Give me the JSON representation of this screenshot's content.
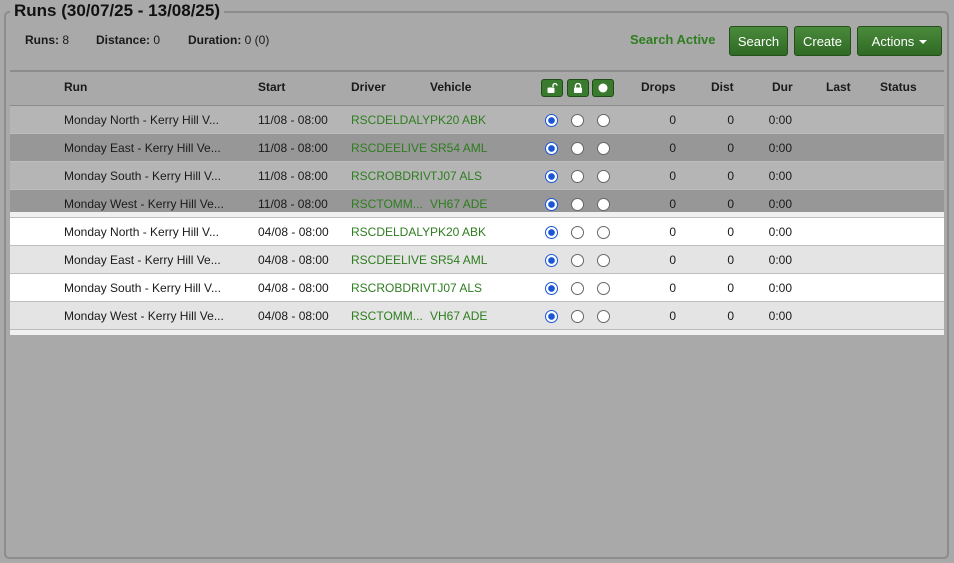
{
  "panel": {
    "title": "Runs (30/07/25 - 13/08/25)"
  },
  "stats": {
    "runs_label": "Runs:",
    "runs_value": "8",
    "distance_label": "Distance:",
    "distance_value": "0",
    "duration_label": "Duration:",
    "duration_value": "0 (0)"
  },
  "toolbar": {
    "search_status": "Search Active",
    "search_label": "Search",
    "create_label": "Create",
    "actions_label": "Actions"
  },
  "colors": {
    "accent_green": "#2e7d1f",
    "button_green": "#3a7a2e",
    "radio_blue": "#1a55d6"
  },
  "table": {
    "headers": {
      "run": "Run",
      "start": "Start",
      "driver": "Driver",
      "vehicle": "Vehicle",
      "drops": "Drops",
      "dist": "Dist",
      "dur": "Dur",
      "last": "Last",
      "status": "Status"
    },
    "lock_icons": [
      "unlock-icon",
      "lock-icon",
      "circle-icon"
    ],
    "rows": [
      {
        "run": "Monday North - Kerry Hill V...",
        "start": "11/08 - 08:00",
        "driver": "RSCDELDALY",
        "vehicle": "PK20 ABK",
        "selected": 0,
        "drops": "0",
        "dist": "0",
        "dur": "0:00",
        "last": "",
        "status": ""
      },
      {
        "run": "Monday East - Kerry Hill Ve...",
        "start": "11/08 - 08:00",
        "driver": "RSCDEELIVE",
        "vehicle": "SR54 AML",
        "selected": 0,
        "drops": "0",
        "dist": "0",
        "dur": "0:00",
        "last": "",
        "status": ""
      },
      {
        "run": "Monday South - Kerry Hill V...",
        "start": "11/08 - 08:00",
        "driver": "RSCROBDRIV",
        "vehicle": "TJ07 ALS",
        "selected": 0,
        "drops": "0",
        "dist": "0",
        "dur": "0:00",
        "last": "",
        "status": ""
      },
      {
        "run": "Monday West - Kerry Hill Ve...",
        "start": "11/08 - 08:00",
        "driver": "RSCTOMM...",
        "vehicle": "VH67 ADE",
        "selected": 0,
        "drops": "0",
        "dist": "0",
        "dur": "0:00",
        "last": "",
        "status": ""
      },
      {
        "run": "Monday North - Kerry Hill V...",
        "start": "04/08 - 08:00",
        "driver": "RSCDELDALY",
        "vehicle": "PK20 ABK",
        "selected": 0,
        "drops": "0",
        "dist": "0",
        "dur": "0:00",
        "last": "",
        "status": ""
      },
      {
        "run": "Monday East - Kerry Hill Ve...",
        "start": "04/08 - 08:00",
        "driver": "RSCDEELIVE",
        "vehicle": "SR54 AML",
        "selected": 0,
        "drops": "0",
        "dist": "0",
        "dur": "0:00",
        "last": "",
        "status": ""
      },
      {
        "run": "Monday South - Kerry Hill V...",
        "start": "04/08 - 08:00",
        "driver": "RSCROBDRIV",
        "vehicle": "TJ07 ALS",
        "selected": 0,
        "drops": "0",
        "dist": "0",
        "dur": "0:00",
        "last": "",
        "status": ""
      },
      {
        "run": "Monday West - Kerry Hill Ve...",
        "start": "04/08 - 08:00",
        "driver": "RSCTOMM...",
        "vehicle": "VH67 ADE",
        "selected": 0,
        "drops": "0",
        "dist": "0",
        "dur": "0:00",
        "last": "",
        "status": ""
      }
    ]
  }
}
